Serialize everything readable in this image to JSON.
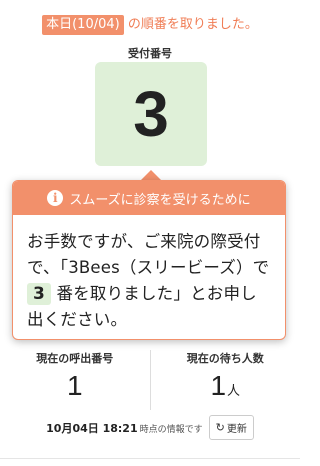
{
  "header": {
    "date_badge": "本日(10/04)",
    "suffix_text": "の順番を取りました。"
  },
  "ticket": {
    "label": "受付番号",
    "number": "3"
  },
  "popup": {
    "title": "スムーズに診察を受けるために",
    "body_before": "お手数ですが、ご来院の際受付で、「3Bees（スリービーズ）で",
    "number": "3",
    "body_after": "番を取りました」とお申し出ください。"
  },
  "stats": {
    "current_call_label": "現在の呼出番号",
    "current_call_value": "1",
    "waiting_label": "現在の待ち人数",
    "waiting_value": "1",
    "waiting_unit": "人"
  },
  "footer": {
    "timestamp": "10月04日 18:21",
    "timestamp_suffix": "時点の情報です",
    "refresh_label": "更新"
  },
  "colors": {
    "accent": "#f2906b",
    "ticket_bg": "#dff0d8"
  }
}
